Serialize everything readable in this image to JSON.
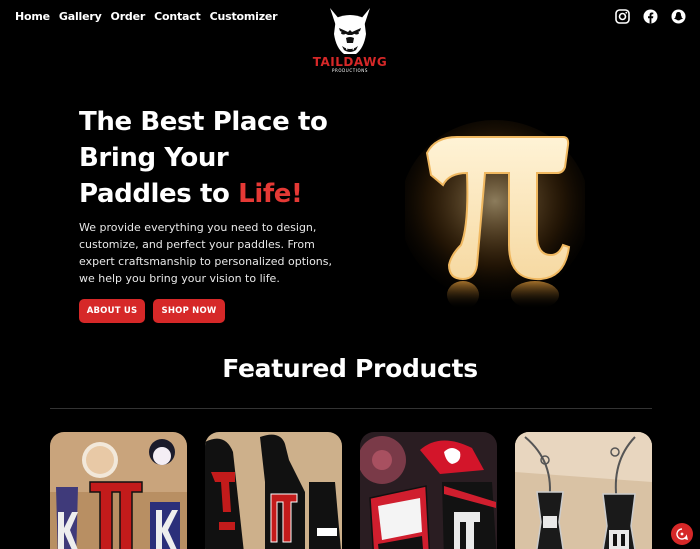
{
  "nav": {
    "items": [
      {
        "label": "Home"
      },
      {
        "label": "Gallery"
      },
      {
        "label": "Order"
      },
      {
        "label": "Contact"
      },
      {
        "label": "Customizer"
      }
    ]
  },
  "logo": {
    "brand": "TAILDAWG",
    "sub": "PRODUCTIONS"
  },
  "social": {
    "icons": [
      "instagram-icon",
      "facebook-icon",
      "snapchat-icon"
    ]
  },
  "hero": {
    "title_line1": "The Best Place to",
    "title_line2": "Bring Your",
    "title_line3_prefix": "Paddles to ",
    "title_line3_accent": "Life!",
    "description": "We provide everything you need to design, customize, and perfect your paddles. From expert craftsmanship to personalized options, we help you bring your vision to life.",
    "about_label": "ABOUT US",
    "shop_label": "SHOP NOW"
  },
  "featured": {
    "title": "Featured Products"
  },
  "colors": {
    "background": "#000000",
    "accent": "#d62828",
    "accent_text": "#e53935",
    "text": "#ffffff"
  }
}
